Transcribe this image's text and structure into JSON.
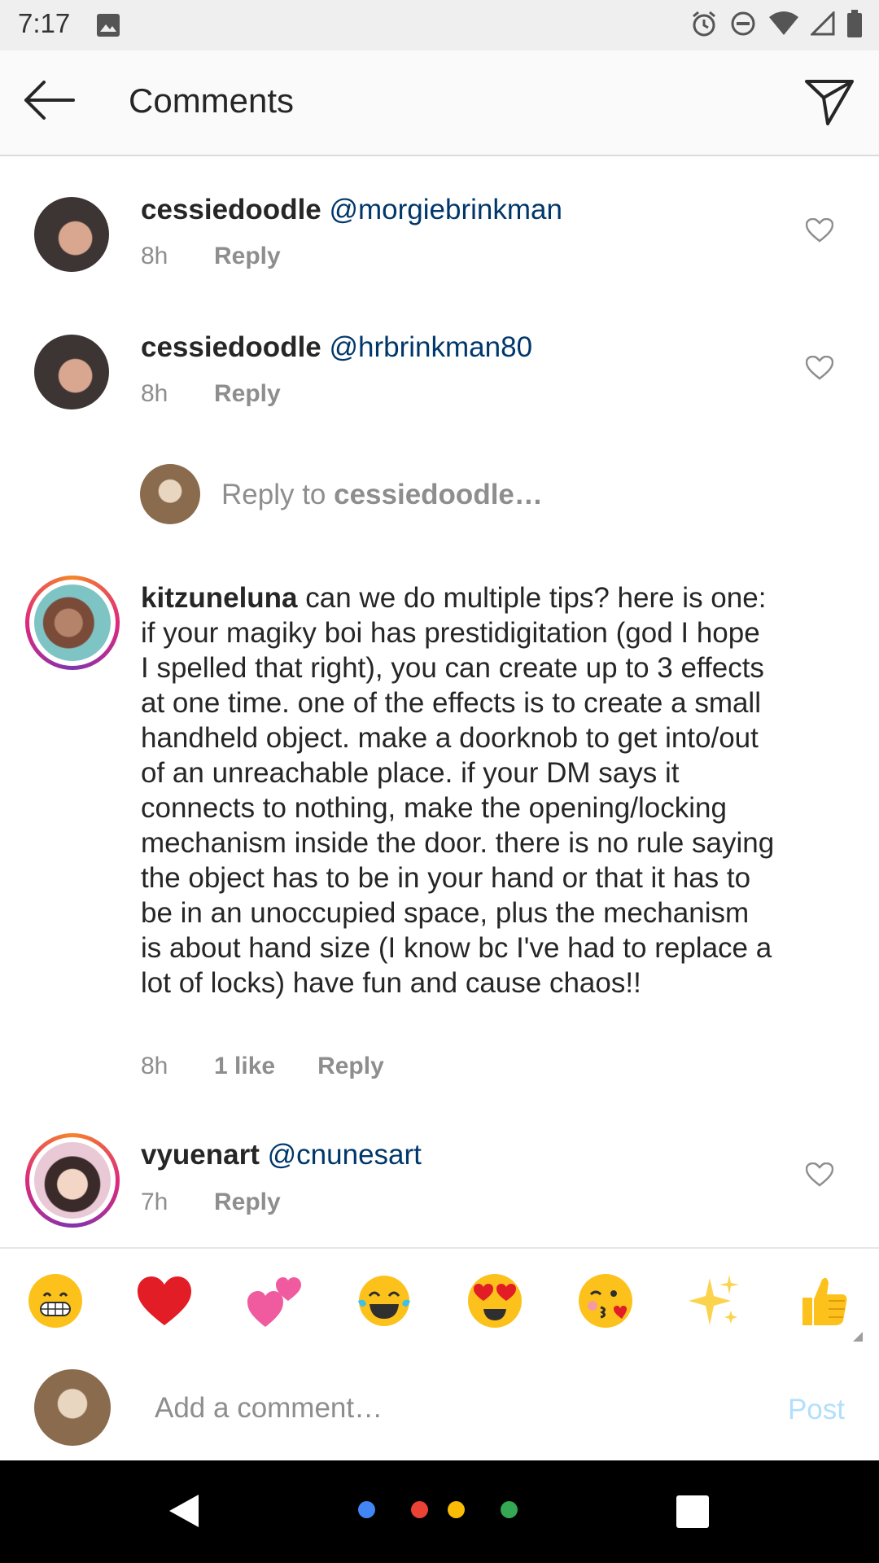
{
  "status": {
    "time": "7:17"
  },
  "header": {
    "title": "Comments"
  },
  "comments": [
    {
      "user": "cessiedoodle",
      "text": "@morgiebrinkman",
      "time": "8h",
      "reply": "Reply"
    },
    {
      "user": "cessiedoodle",
      "text": "@hrbrinkman80",
      "time": "8h",
      "reply": "Reply"
    },
    {
      "user": "kitzuneluna",
      "text": "can we do multiple tips? here is one: if your magiky boi has prestidigitation (god I hope I spelled that right), you can create up to 3 effects at one time. one of the effects is to create a small handheld object. make a doorknob to get into/out of an unreachable place. if your DM says it connects to nothing, make the opening/locking mechanism inside the door. there is no rule saying the object has to be in your hand or that it has to be in an unoccupied space, plus the mechanism is about hand size (I know bc I've had to replace a lot of locks) have fun and cause chaos!!",
      "time": "8h",
      "likes": "1 like",
      "reply": "Reply"
    },
    {
      "user": "vyuenart",
      "text": "@cnunesart",
      "time": "7h",
      "reply": "Reply"
    }
  ],
  "reply_prompt": {
    "prefix": "Reply to ",
    "user": "cessiedoodle…"
  },
  "emoji_bar": [
    "😁",
    "❤️",
    "💕",
    "😂",
    "😍",
    "😘",
    "✨",
    "👍"
  ],
  "composer": {
    "placeholder": "Add a comment…",
    "post": "Post"
  },
  "colors": {
    "mention": "#00376b",
    "muted": "#8e8e8e",
    "post_disabled": "#b2dffc"
  }
}
